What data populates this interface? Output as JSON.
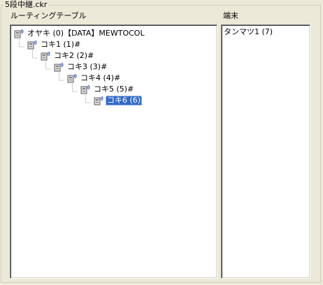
{
  "group_title": "5段中継.ckr",
  "routing_panel": {
    "label": "ルーティングテーブル",
    "nodes": [
      {
        "label": "オヤキ (0)【DATA】MEWTOCOL",
        "selected": false
      },
      {
        "label": "コキ1 (1)#",
        "selected": false
      },
      {
        "label": "コキ2 (2)#",
        "selected": false
      },
      {
        "label": "コキ3 (3)#",
        "selected": false
      },
      {
        "label": "コキ4 (4)#",
        "selected": false
      },
      {
        "label": "コキ5 (5)#",
        "selected": false
      },
      {
        "label": "コキ6 (6)",
        "selected": true
      }
    ]
  },
  "terminal_panel": {
    "label": "端末",
    "items": [
      "タンマツ1 (7)"
    ]
  },
  "icon_name": "network-node-icon",
  "selection_color": "#316ac5"
}
